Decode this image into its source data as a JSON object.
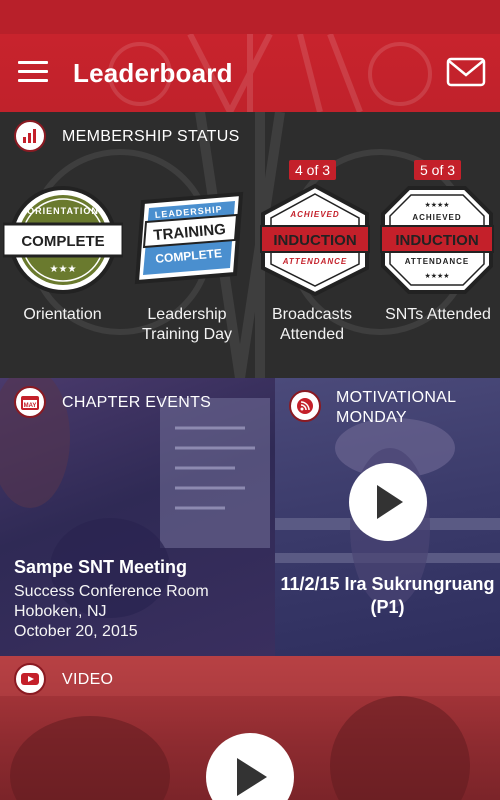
{
  "header": {
    "title": "Leaderboard"
  },
  "membership": {
    "section_label": "MEMBERSHIP STATUS",
    "badges": [
      {
        "label": "Orientation",
        "count": "",
        "badge_top": "ORIENTATION",
        "badge_main": "COMPLETE"
      },
      {
        "label": "Leadership Training Day",
        "count": "",
        "badge_top": "LEADERSHIP",
        "badge_main": "TRAINING",
        "badge_sub": "COMPLETE"
      },
      {
        "label": "Broadcasts Attended",
        "count": "4 of 3",
        "badge_top": "ACHIEVED",
        "badge_main": "INDUCTION",
        "badge_sub": "ATTENDANCE"
      },
      {
        "label": "SNTs Attended",
        "count": "5 of 3",
        "badge_top": "ACHIEVED",
        "badge_main": "INDUCTION",
        "badge_sub": "ATTENDANCE"
      }
    ]
  },
  "events": {
    "section_label": "CHAPTER EVENTS",
    "title": "Sampe SNT Meeting",
    "location": "Success Conference Room",
    "city": "Hoboken, NJ",
    "date": "October 20, 2015",
    "icon_text": "MAY"
  },
  "motivational": {
    "section_label": "MOTIVATIONAL MONDAY",
    "title": "11/2/15 Ira Sukrungruang (P1)"
  },
  "video": {
    "section_label": "VIDEO"
  },
  "colors": {
    "brand_red": "#c8232d",
    "dark_panel": "#2d2d2d",
    "events_tint": "#3a2f5f",
    "video_tint": "#8e2b30"
  }
}
